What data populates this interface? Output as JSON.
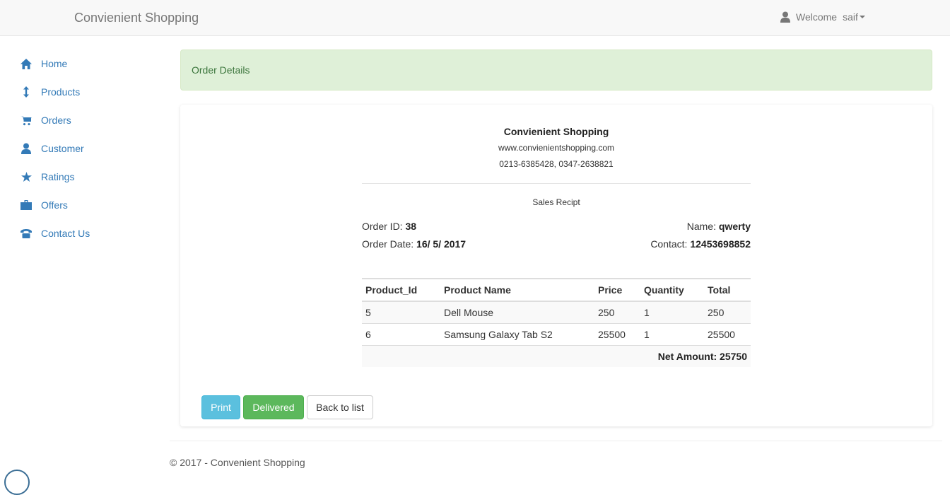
{
  "navbar": {
    "brand": "Convienient Shopping",
    "welcome": "Welcome",
    "username": "saif"
  },
  "sidebar": {
    "items": [
      {
        "label": "Home",
        "icon": "home-icon"
      },
      {
        "label": "Products",
        "icon": "resize-vertical-icon"
      },
      {
        "label": "Orders",
        "icon": "shopping-cart-icon"
      },
      {
        "label": "Customer",
        "icon": "user-icon"
      },
      {
        "label": "Ratings",
        "icon": "star-icon"
      },
      {
        "label": "Offers",
        "icon": "briefcase-icon"
      },
      {
        "label": "Contact Us",
        "icon": "phone-alt-icon"
      }
    ]
  },
  "alert": {
    "text": "Order Details"
  },
  "receipt": {
    "company": "Convienient Shopping",
    "website": "www.convienientshopping.com",
    "phones": "0213-6385428, 0347-2638821",
    "title": "Sales Recipt",
    "order_id_label": "Order ID:",
    "order_id": "38",
    "order_date_label": "Order Date:",
    "order_date": "16/ 5/ 2017",
    "name_label": "Name:",
    "name": "qwerty",
    "contact_label": "Contact:",
    "contact": "12453698852"
  },
  "table": {
    "headers": [
      "Product_Id",
      "Product Name",
      "Price",
      "Quantity",
      "Total"
    ],
    "rows": [
      [
        "5",
        "Dell Mouse",
        "250",
        "1",
        "250"
      ],
      [
        "6",
        "Samsung Galaxy Tab S2",
        "25500",
        "1",
        "25500"
      ]
    ],
    "net_amount": "Net Amount: 25750"
  },
  "buttons": {
    "print": "Print",
    "delivered": "Delivered",
    "back": "Back to list"
  },
  "footer": {
    "text": "© 2017 - Convenient Shopping"
  },
  "colors": {
    "link": "#337ab7",
    "alert_bg": "#dff0d8",
    "info": "#5bc0de",
    "success": "#5cb85c"
  }
}
